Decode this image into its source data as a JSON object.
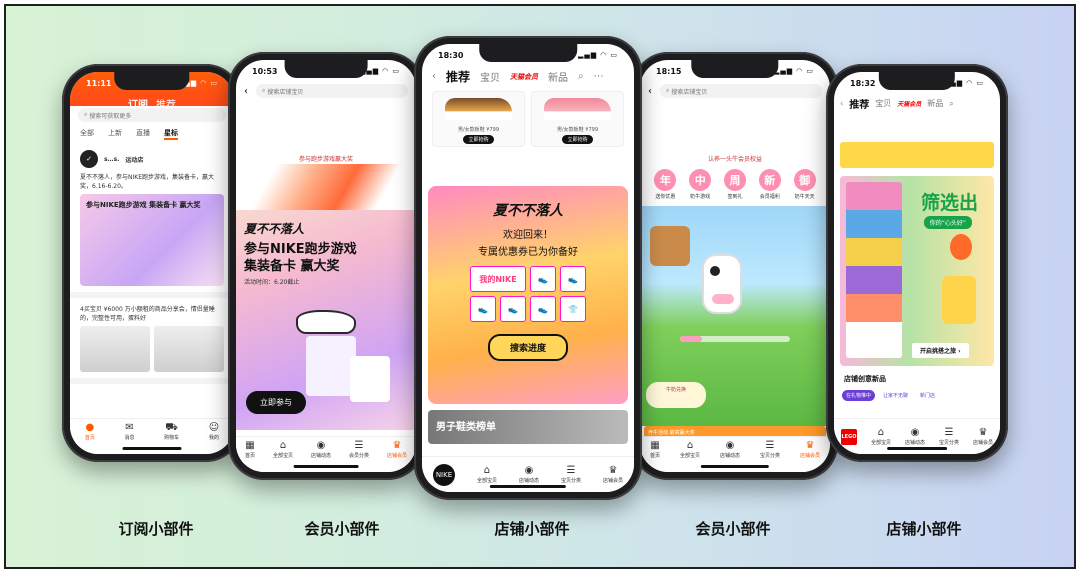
{
  "captions": [
    "订阅小部件",
    "会员小部件",
    "店铺小部件",
    "会员小部件",
    "店铺小部件"
  ],
  "phone1": {
    "time": "11:11",
    "tabs_top": [
      "订阅",
      "推荐"
    ],
    "search_placeholder": "搜索可获取更多",
    "feed_tabs": [
      "全部",
      "上新",
      "直播",
      "星标"
    ],
    "post1_user": "s…s.",
    "post1_shop": "运动店",
    "post1_text": "夏不不落人，参与NIKE跑步游戏，集装备卡，赢大奖，6.16-6.20。",
    "post1_card": "参与NIKE跑步游戏 集装备卡 赢大奖",
    "post2_text": "4买宝贝 ¥6000 万小额租的商品分享会，情侣量睡的，完整性可用，蛋料好",
    "tabbar": [
      "首页",
      "消息",
      "购物车",
      "我的"
    ]
  },
  "phone2": {
    "time": "10:53",
    "search_placeholder": "搜索店铺宝贝",
    "banner": "参与跑步游戏赢大奖",
    "brand": "夏不不落人",
    "title_line1": "参与NIKE跑步游戏",
    "title_line2": "集装备卡 赢大奖",
    "sub": "活动时间：6.20截止",
    "join_label": "立即参与",
    "tabbar": [
      "首页",
      "全部宝贝",
      "店铺动态",
      "会员分类",
      "店铺会员"
    ]
  },
  "phone3": {
    "time": "18:30",
    "tabs": [
      "推荐",
      "宝贝",
      "新品"
    ],
    "brand_tab": "天猫会员",
    "shoe1_text": "男/女款板鞋 ¥799",
    "shoe2_text": "男/女款板鞋 ¥799",
    "shoe1_btn": "立即抢购",
    "shoe2_btn": "立即抢购",
    "welcome_brand": "夏不不落人",
    "welcome_line1": "欢迎回来！",
    "welcome_line2": "专属优惠券已为你备好",
    "my_nike": "我的NIKE",
    "progress_label": "搜索进度",
    "men_strip": "男子鞋类榜单",
    "swoosh_text": "NIKE",
    "tabbar": [
      "全部宝贝",
      "店铺动态",
      "宝贝分类",
      "店铺会员"
    ]
  },
  "phone4": {
    "time": "18:15",
    "search_placeholder": "搜索店铺宝贝",
    "member_banner": "认养一头牛会员权益",
    "icons": [
      {
        "char": "年",
        "label": "送你优惠"
      },
      {
        "char": "中",
        "label": "奶牛游戏"
      },
      {
        "char": "周",
        "label": "签到礼"
      },
      {
        "char": "新",
        "label": "会员福利"
      },
      {
        "char": "御",
        "label": "奶牛天天"
      }
    ],
    "game_box": "牛奶兑换",
    "orange_strip": "养牛活动 最高赢大奖",
    "tabbar": [
      "首页",
      "全部宝贝",
      "店铺动态",
      "宝贝分类",
      "店铺会员"
    ]
  },
  "phone5": {
    "time": "18:32",
    "tabs": [
      "推荐",
      "宝贝",
      "新品"
    ],
    "brand_tab": "天猫会员",
    "hero_big": "筛选出",
    "hero_small": "你的“心头好”",
    "open_label": "开启挑搭之旅",
    "new_title": "店铺创意新品",
    "chips": [
      "在礼物堆中",
      "让家不无聊",
      "新门店"
    ],
    "logo_text": "LEGO",
    "tabbar": [
      "全部宝贝",
      "店铺动态",
      "宝贝分类",
      "店铺会员"
    ]
  }
}
